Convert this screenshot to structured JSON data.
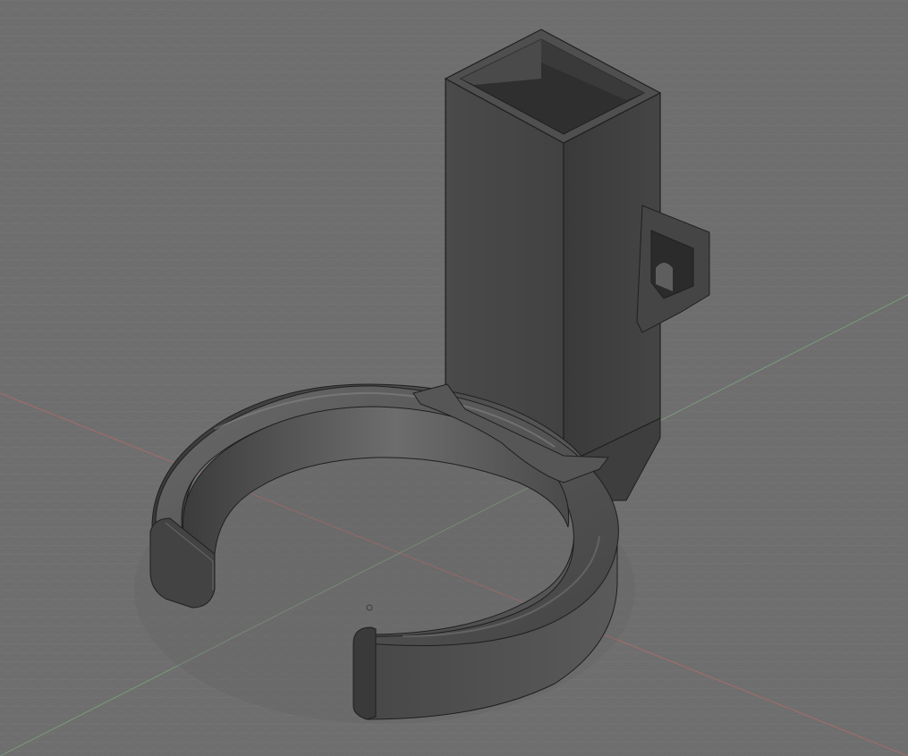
{
  "viewport": {
    "background": "#6e6e6e",
    "grid_minor_color": "#7d7d7d",
    "grid_major_color": "#8a8a8a",
    "x_axis_color": "#b36b6b",
    "z_axis_color": "#7fa37f"
  },
  "model": {
    "body_color": "#4a4a4a",
    "face_light": "#5a5a5a",
    "face_dark": "#3b3b3b",
    "edge_color": "#1e1e1e",
    "highlight_color": "#8c8c8c"
  },
  "icons": {
    "origin": "origin-icon"
  }
}
